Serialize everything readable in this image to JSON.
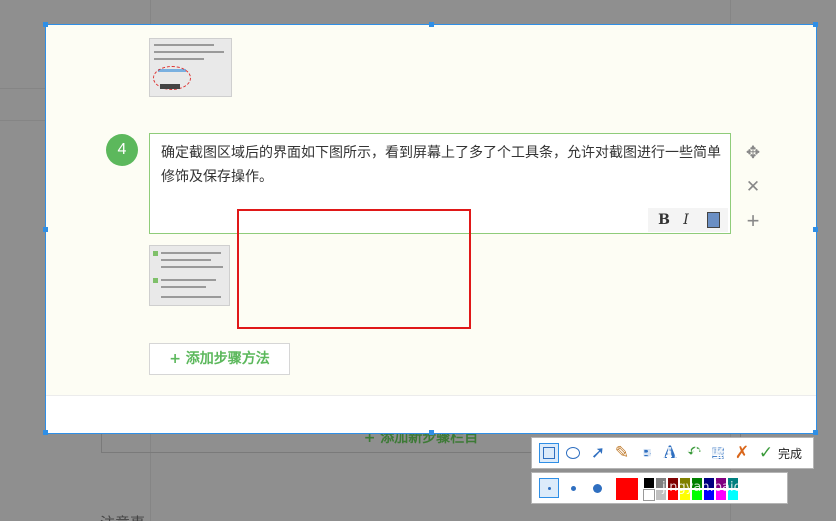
{
  "step": {
    "number": "4",
    "text": "确定截图区域后的界面如下图所示，看到屏幕上了多了个工具条，允许对截图进行一些简单修饰及保存操作。",
    "format_bold": "B",
    "format_italic": "I"
  },
  "buttons": {
    "add_method": "+ 添加步骤方法",
    "add_section": "+ 添加新步骤栏目"
  },
  "side_icons": [
    "move-icon",
    "close-icon",
    "plus-icon"
  ],
  "toolbar": {
    "tools": [
      "rectangle-icon",
      "ellipse-icon",
      "arrow-icon",
      "brush-icon",
      "save-icon",
      "text-icon",
      "undo-icon",
      "copy-icon",
      "cancel-icon",
      "done-icon"
    ],
    "done_label": "完成",
    "selected_color": "#ff0000",
    "palette": [
      "#000000",
      "#808080",
      "#800000",
      "#808000",
      "#008000",
      "#000080",
      "#800080",
      "#008080",
      "#ffffff",
      "#c0c0c0",
      "#ff0000",
      "#ffff00",
      "#00ff00",
      "#0000ff",
      "#ff00ff",
      "#00ffff"
    ]
  },
  "watermark": {
    "text": "Bai度经验",
    "sub": "jingyan.baidu.com"
  },
  "bg_text": "注意事"
}
